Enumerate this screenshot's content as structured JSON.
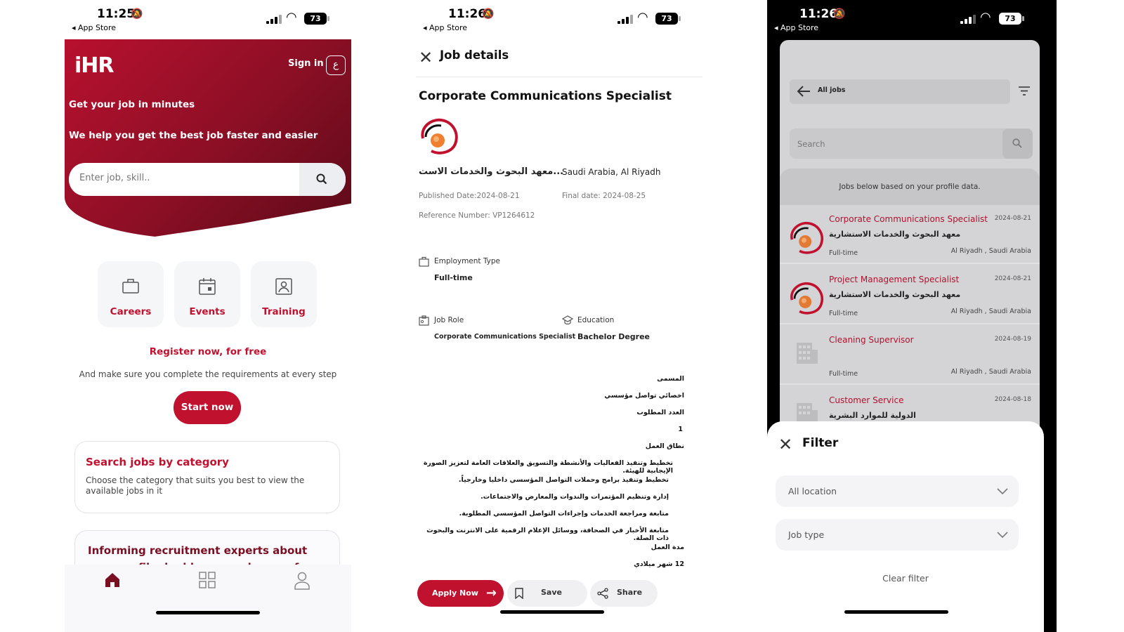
{
  "status": [
    {
      "time": "11:25",
      "back": "◂ App Store",
      "battery": "73"
    },
    {
      "time": "11:26",
      "back": "◂ App Store",
      "battery": "73"
    },
    {
      "time": "11:26",
      "back": "◂ App Store",
      "battery": "73"
    }
  ],
  "home": {
    "logo": "iHR",
    "signin": "Sign in",
    "lang": "ع",
    "title": "Get your job in minutes",
    "subtitle": "We help you get the best job faster and easier",
    "search_placeholder": "Enter job, skill..",
    "tiles": [
      {
        "label": "Careers",
        "icon": "briefcase-icon"
      },
      {
        "label": "Events",
        "icon": "calendar-icon"
      },
      {
        "label": "Training",
        "icon": "training-icon"
      }
    ],
    "register": "Register now, for free",
    "register_sub": "And make sure you complete the requirements at every step",
    "start": "Start now",
    "category_title": "Search jobs by category",
    "category_sub": "Choose the category that suits you best to view the available jobs in it",
    "promo_title": "Informing recruitment experts about your profile doubles your chance of being",
    "nav": [
      "home-icon",
      "grid-icon",
      "profile-icon"
    ]
  },
  "details": {
    "header": "Job details",
    "title": "Corporate Communications Specialist",
    "company": "معهد البحوث والخدمات الاست...",
    "location": "Saudi Arabia, Al Riyadh",
    "published": "Published Date:2024-08-21",
    "final": "Final date: 2024-08-25",
    "reference": "Reference Number: VP1264612",
    "employment_type_label": "Employment Type",
    "employment_type": "Full-time",
    "job_role_label": "Job Role",
    "job_role": "Corporate Communications Specialist",
    "education_label": "Education",
    "education": "Bachelor Degree",
    "description": [
      "المسمى",
      "اخصائي تواصل مؤسسي",
      "العدد المطلوب",
      "1",
      "نطاق العمل",
      "تخطيط وتنفيذ الفعاليات والأنشطة والتسويق والعلاقات العامة لتعزيز الصورة الإيجابية للهيئة.",
      "تخطيط وتنفيذ برامج وحملات التواصل المؤسسي داخليا وخارجياً.",
      "إدارة وتنظيم المؤتمرات والندوات والمعارض والاجتماعات.",
      "متابعة ومراجعة الخدمات وإجراءات التواصل المؤسسي المطلوبة.",
      "متابعة الأخبار في الصحافة، ووسائل الإعلام الرقمية على الانترنت والبحوث ذات الصلة.",
      "مدة العمل",
      "12 شهر ميلادي"
    ],
    "apply": "Apply Now",
    "save": "Save",
    "share": "Share"
  },
  "jobs": {
    "topbar": "All jobs",
    "search_placeholder": "Search",
    "info": "Jobs below based on your profile data.",
    "list": [
      {
        "title": "Corporate Communications Specialist",
        "date": "2024-08-21",
        "company": "معهد البحوث والخدمات الاستشارية",
        "type": "Full-time",
        "location": "Al Riyadh , Saudi Arabia",
        "logo": "company-logo"
      },
      {
        "title": "Project Management Specialist",
        "date": "2024-08-21",
        "company": "معهد البحوث والخدمات الاستشارية",
        "type": "Full-time",
        "location": "Al Riyadh , Saudi Arabia",
        "logo": "company-logo"
      },
      {
        "title": "Cleaning Supervisor",
        "date": "2024-08-19",
        "company": "",
        "type": "Full-time",
        "location": "Al Riyadh , Saudi Arabia",
        "logo": "building-icon"
      },
      {
        "title": "Customer Service",
        "date": "2024-08-18",
        "company": "الدولية للموارد البشرية",
        "type": "",
        "location": "",
        "logo": "building-icon"
      }
    ],
    "filter_title": "Filter",
    "location_select": "All location",
    "jobtype_select": "Job type",
    "clear": "Clear filter"
  },
  "colors": {
    "brand": "#c0122f",
    "brand_dark": "#5b0a18"
  }
}
